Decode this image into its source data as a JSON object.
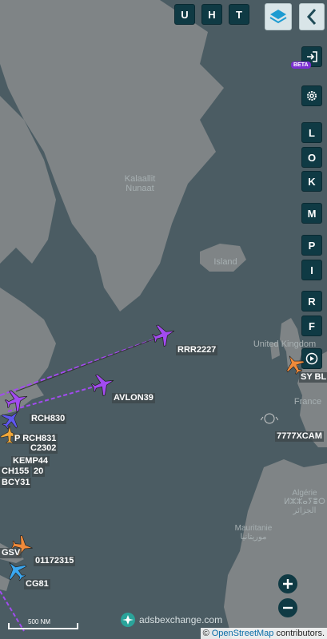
{
  "header": {
    "top_buttons": [
      "U",
      "H",
      "T"
    ]
  },
  "sidebar": {
    "buttons": [
      "L",
      "O",
      "K",
      "M",
      "P",
      "I",
      "R",
      "F"
    ],
    "beta_badge": "BETA"
  },
  "map_labels": {
    "greenland": "Kalaallit\nNunaat",
    "iceland": "Island",
    "uk": "United Kingdom",
    "france": "France",
    "algeria": "Algérie\nⵍⵣⵣⴰⵢⴻⵔ\nالجزائر",
    "mauritania": "Mauritanie\nموريتانيا"
  },
  "aircraft": [
    {
      "callsign": "RRR2227",
      "color": "#a24bf0"
    },
    {
      "callsign": "AVLON39",
      "color": "#a24bf0"
    },
    {
      "callsign": "RCH830",
      "color": "#a24bf0"
    },
    {
      "callsign": "P RCH831",
      "color": "#5f57f0"
    },
    {
      "callsign": "C2302",
      "color": "#4f7cf0"
    },
    {
      "callsign": "KEMP44",
      "color": "#4f7cf0"
    },
    {
      "callsign": "CH155",
      "color": "#3aa7f0"
    },
    {
      "callsign": "20",
      "color": "#3aa7f0"
    },
    {
      "callsign": "BCY31",
      "color": "#3aa7f0"
    },
    {
      "callsign": "GSV",
      "color": "#f08a3a"
    },
    {
      "callsign": "01172315",
      "color": "#3aa7f0"
    },
    {
      "callsign": "CG81",
      "color": "#3aa7f0"
    },
    {
      "callsign": "7777XCAM",
      "color": "#f08a3a"
    },
    {
      "callsign": "SY BL",
      "color": "#f08a3a"
    }
  ],
  "scale": {
    "label": "500 NM"
  },
  "branding": {
    "name": "adsbexchange.com"
  },
  "attribution": {
    "prefix": "©",
    "link": "OpenStreetMap",
    "suffix": "contributors."
  },
  "colors": {
    "sea": "#4b5c63",
    "land": "#7f8486",
    "ui_dark": "#0f3a44",
    "track": "#a24bf0"
  }
}
